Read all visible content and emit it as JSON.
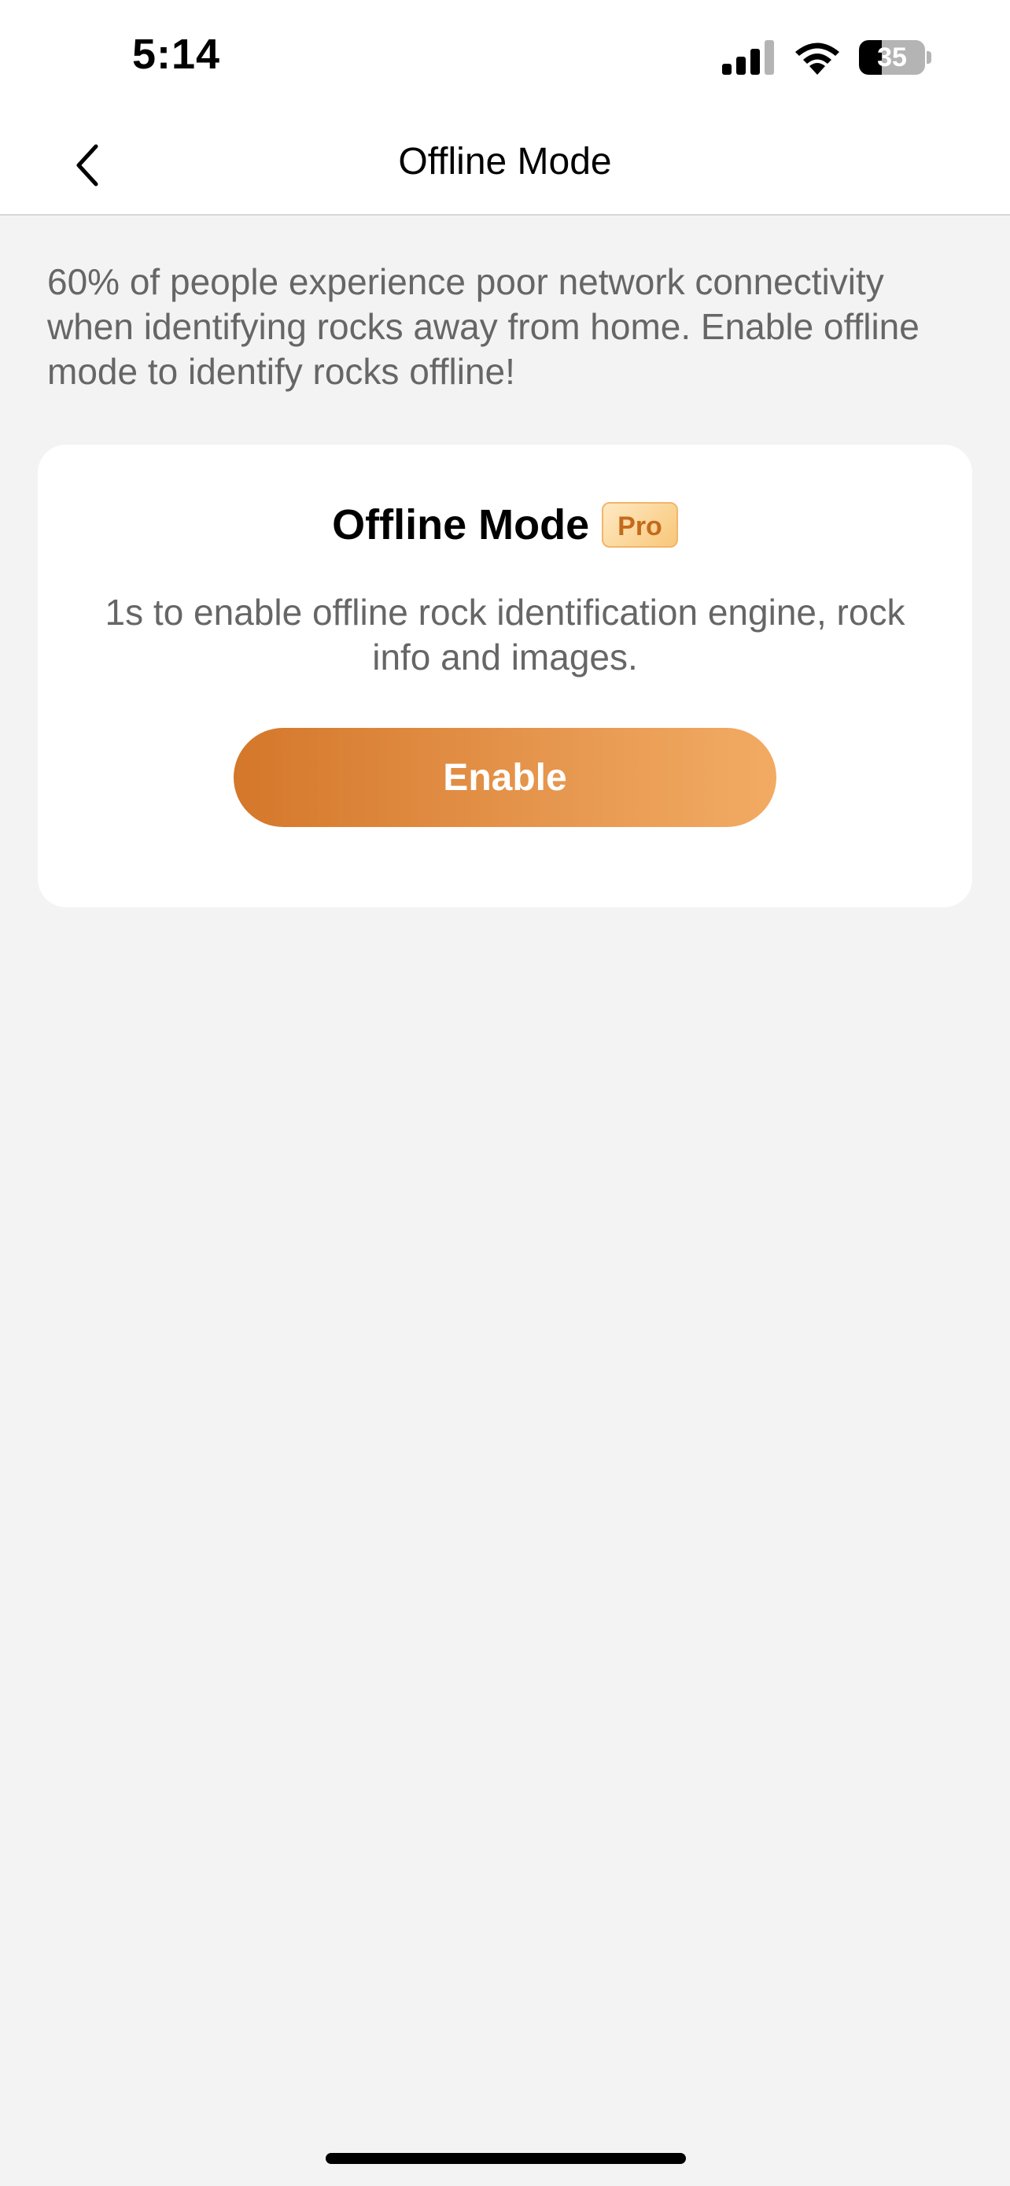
{
  "status_bar": {
    "time": "5:14",
    "battery_level": "35",
    "battery_fraction": 0.35,
    "icons": [
      "signal-icon",
      "wifi-icon",
      "battery-icon"
    ]
  },
  "nav": {
    "title": "Offline Mode",
    "back_icon": "chevron-left-icon"
  },
  "intro": {
    "text": "60% of people experience poor network connectivity when identifying rocks away from home. Enable offline mode to identify rocks offline!"
  },
  "card": {
    "title": "Offline Mode",
    "badge": "Pro",
    "description": "1s to enable offline rock identification engine, rock info and images.",
    "button_label": "Enable"
  },
  "colors": {
    "accent_start": "#d4772a",
    "accent_end": "#f2ab63",
    "badge_text": "#c46a1c",
    "body_text": "#666666",
    "background": "#f3f3f3"
  }
}
